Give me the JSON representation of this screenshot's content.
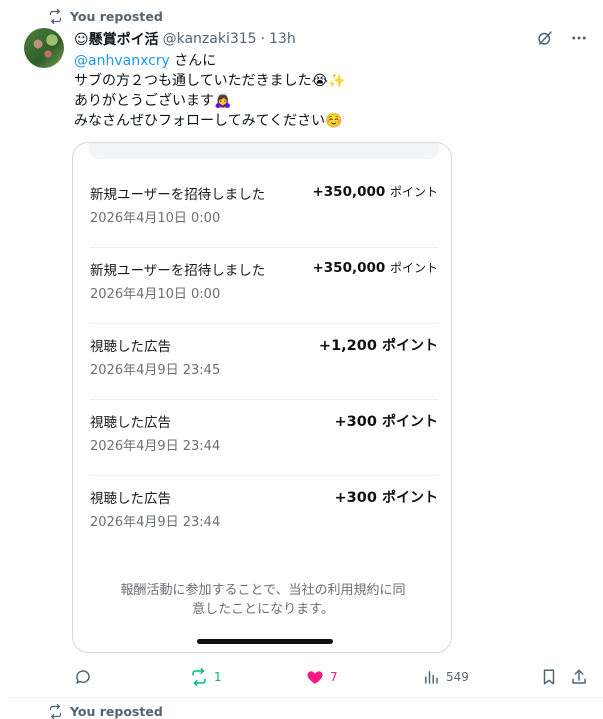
{
  "repost_banner": {
    "label": "You reposted"
  },
  "author": {
    "name": "☺懸賞ポイ活",
    "handle": "@kanzaki315",
    "separator": "·",
    "time": "13h"
  },
  "tweet": {
    "mention": "@anhvanxcry",
    "line1_suffix": " さんに",
    "line2": "サブの方２つも通していただきました",
    "line2_emoji": "😭✨",
    "line3": "ありがとうございます",
    "line3_emoji": "🙇‍♀️",
    "line4": "みなさんぜひフォローしてみてください",
    "line4_emoji": "☺️"
  },
  "card": {
    "rows": [
      {
        "title": "新規ユーザーを招待しました",
        "date": "2026年4月10日 0:00",
        "amount": "+350,000",
        "unit": "ポイント"
      },
      {
        "title": "新規ユーザーを招待しました",
        "date": "2026年4月10日 0:00",
        "amount": "+350,000",
        "unit": "ポイント"
      },
      {
        "title": "視聴した広告",
        "date": "2026年4月9日 23:45",
        "amount": "+1,200",
        "unit": "ポイント"
      },
      {
        "title": "視聴した広告",
        "date": "2026年4月9日 23:44",
        "amount": "+300",
        "unit": "ポイント"
      },
      {
        "title": "視聴した広告",
        "date": "2026年4月9日 23:44",
        "amount": "+300",
        "unit": "ポイント"
      }
    ],
    "terms_line1": "報酬活動に参加することで、当社の利用規約に同",
    "terms_line2": "意したことになります。"
  },
  "actions": {
    "reply_count": "",
    "retweet_count": "1",
    "like_count": "7",
    "views_count": "549"
  },
  "next_repost_banner": {
    "label": "You reposted"
  },
  "colors": {
    "accent_blue": "#1d9bf0",
    "retweet_green": "#00ba7c",
    "like_pink": "#f91880",
    "secondary_text": "#536471"
  }
}
